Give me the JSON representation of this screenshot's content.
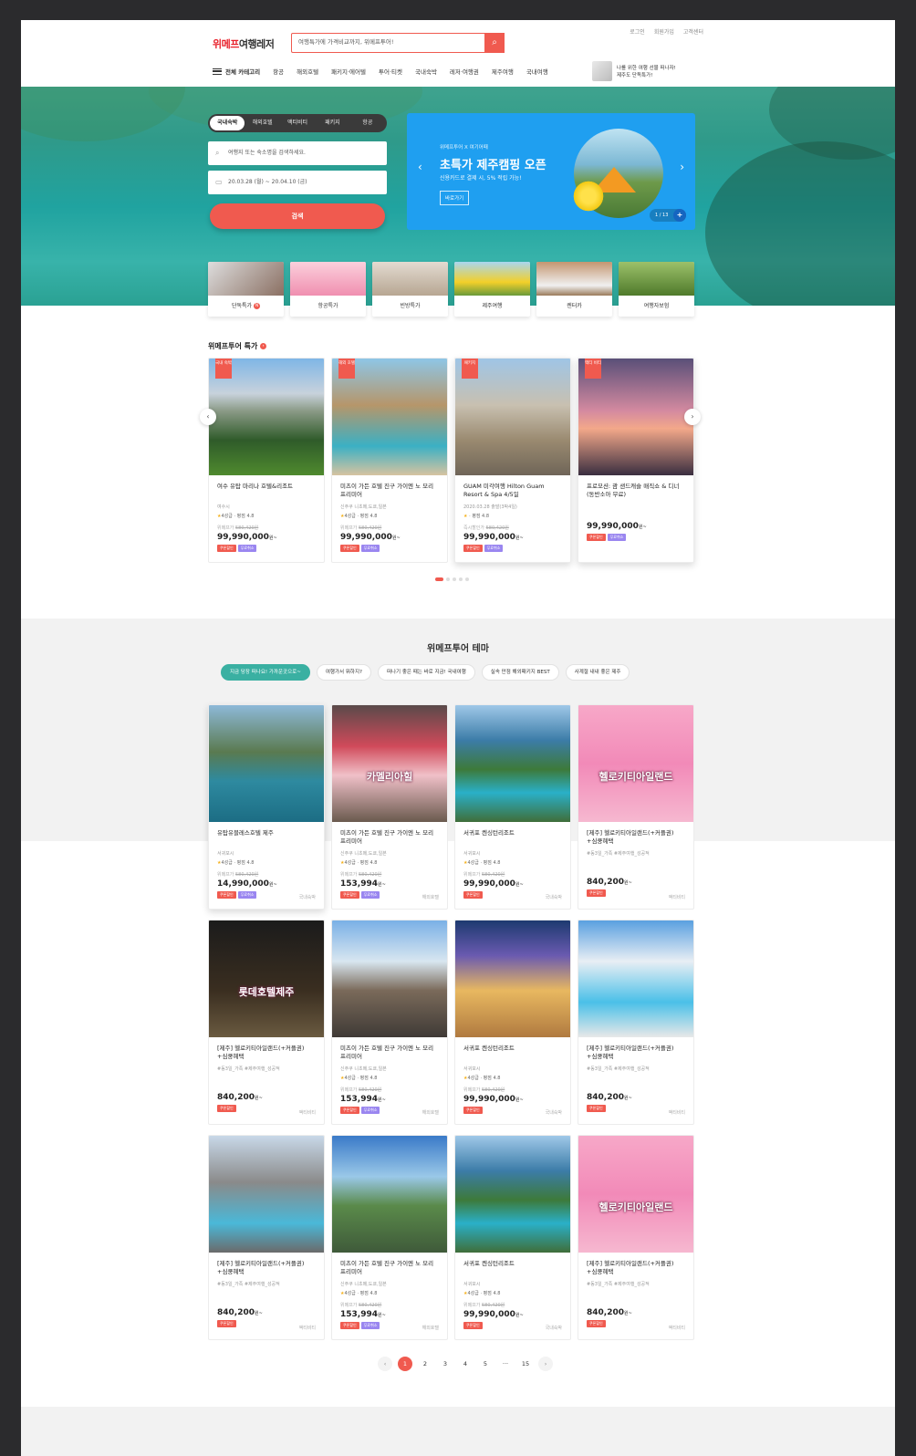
{
  "header": {
    "util": [
      "로그인",
      "회원가입",
      "고객센터"
    ],
    "logo_red": "위메프",
    "logo_dark": "여행레저",
    "search_placeholder": "여행특가에 가격비교까지, 위메프투어!",
    "menu_label": "전체 카테고리",
    "nav": [
      "항공",
      "해외호텔",
      "패키지·에어텔",
      "투어·티켓",
      "국내숙박",
      "레저·여행권",
      "제주여행",
      "국내여행"
    ],
    "promo_line1": "나를 위한 여행 선물 떠나자!",
    "promo_line2": "제주도 단독특가!"
  },
  "hero": {
    "tabs": [
      "국내숙박",
      "해외호텔",
      "액티비티",
      "패키지",
      "항공"
    ],
    "search_placeholder": "여행지 또는 숙소명을 검색하세요.",
    "dates": "20.03.28 (월) ~ 20.04.10 (금)",
    "search_button": "검색",
    "banner": {
      "sub": "위메프투어 X 여기어때",
      "title": "초특가 제주캠핑 오픈",
      "desc": "신용카드로 결제 시, 5% 적립 가능!",
      "go": "바로가기",
      "counter": "1 / 13"
    },
    "quick": [
      "단독특가",
      "항공특가",
      "빈방특가",
      "제주여행",
      "렌터카",
      "여행자보험"
    ]
  },
  "special": {
    "title": "위메프투어 특가",
    "cards": [
      {
        "tag": "국내\n숙박",
        "title": "여수 유탑 마리나 호텔&리조트",
        "loc": "여수시",
        "grade": "4성급",
        "rating": "평점 4.8",
        "orig_label": "위메프가",
        "orig": "580,420원",
        "price": "99,990,000",
        "unit": "원~",
        "tags": [
          "쿠폰할인",
          "무료취소"
        ]
      },
      {
        "tag": "해외\n호텔",
        "title": "미츠이 가든 호텔 진구 가이엔 노 모리 프리미어",
        "loc": "신주쿠 니초메,도쿄,일본",
        "grade": "4성급",
        "rating": "평점 4.8",
        "orig_label": "위메프가",
        "orig": "580,420원",
        "price": "99,990,000",
        "unit": "원~",
        "tags": [
          "쿠폰할인",
          "무료취소"
        ]
      },
      {
        "tag": "패키지",
        "title": "GUAM 미각여행 Hilton Guam Resort & Spa 4/5일",
        "loc": "2020.03.28 출발(3박4일)",
        "grade": "",
        "rating": "평점 4.8",
        "orig_label": "즉시할인가",
        "orig": "580,420원",
        "price": "99,990,000",
        "unit": "원~",
        "tags": [
          "쿠폰할인",
          "무료취소"
        ]
      },
      {
        "tag": "액티\n비티",
        "title": "프로모션: 괌 샌드캐슬 매직쇼 & 디너 (동반소아 무료)",
        "loc": "",
        "grade": "",
        "rating": "",
        "orig_label": "",
        "orig": "",
        "price": "99,990,000",
        "unit": "원~",
        "tags": [
          "쿠폰할인",
          "무료취소"
        ]
      }
    ]
  },
  "theme": {
    "title": "위메프투어 테마",
    "chips": [
      "지금 당장 떠나요! 가까운곳으로~",
      "여행가서 뭐하지?",
      "떠나기 좋은 때는 바로 지금! 국내여행",
      "실속 만점 해외패키지 BEST",
      "사계절 내내 좋은 제주"
    ],
    "cards": [
      {
        "title": "유탑유블레스호텔 제주",
        "loc": "서귀포시",
        "grade": "4성급",
        "rating": "평점 4.8",
        "orig_label": "위메프가",
        "orig": "580,420원",
        "price": "14,990,000",
        "unit": "원~",
        "tags": [
          "쿠폰할인",
          "무료취소"
        ],
        "type": "국내숙박",
        "img": "a"
      },
      {
        "title": "미츠이 가든 호텔 진구 가이엔 노 모리 프리미어",
        "loc": "신주쿠 니초메,도쿄,일본",
        "grade": "4성급",
        "rating": "평점 4.8",
        "orig_label": "위메프가",
        "orig": "580,420원",
        "price": "153,994",
        "unit": "원~",
        "tags": [
          "쿠폰할인",
          "무료취소"
        ],
        "type": "해외호텔",
        "img": "b",
        "overlay": "카멜리아힐"
      },
      {
        "title": "서귀포 켄싱턴리조트",
        "loc": "서귀포시",
        "grade": "4성급",
        "rating": "평점 4.8",
        "orig_label": "위메프가",
        "orig": "580,420원",
        "price": "99,990,000",
        "unit": "원~",
        "tags": [
          "쿠폰할인"
        ],
        "type": "국내숙박",
        "img": "c"
      },
      {
        "title": "[제주] 헬로키티아일랜드(+커플권) +심쿵혜택",
        "loc": "#동3일_가족 #제주여행_성공적",
        "grade": "",
        "rating": "",
        "orig_label": "",
        "orig": "",
        "price": "840,200",
        "unit": "원~",
        "tags": [
          "쿠폰할인"
        ],
        "type": "액티비티",
        "img": "d",
        "overlay": "헬로키티아일랜드"
      },
      {
        "title": "[제주] 헬로키티아일랜드(+커플권) +심쿵혜택",
        "loc": "#동3일_가족 #제주여행_성공적",
        "grade": "",
        "rating": "",
        "orig_label": "",
        "orig": "",
        "price": "840,200",
        "unit": "원~",
        "tags": [
          "쿠폰할인"
        ],
        "type": "액티비티",
        "img": "e",
        "overlay": "롯데호텔제주"
      },
      {
        "title": "미츠이 가든 호텔 진구 가이엔 노 모리 프리미어",
        "loc": "신주쿠 니초메,도쿄,일본",
        "grade": "4성급",
        "rating": "평점 4.8",
        "orig_label": "위메프가",
        "orig": "580,420원",
        "price": "153,994",
        "unit": "원~",
        "tags": [
          "쿠폰할인",
          "무료취소"
        ],
        "type": "해외호텔",
        "img": "f"
      },
      {
        "title": "서귀포 켄싱턴리조트",
        "loc": "서귀포시",
        "grade": "4성급",
        "rating": "평점 4.8",
        "orig_label": "위메프가",
        "orig": "580,420원",
        "price": "99,990,000",
        "unit": "원~",
        "tags": [
          "쿠폰할인"
        ],
        "type": "국내숙박",
        "img": "g"
      },
      {
        "title": "[제주] 헬로키티아일랜드(+커플권) +심쿵혜택",
        "loc": "#동3일_가족 #제주여행_성공적",
        "grade": "",
        "rating": "",
        "orig_label": "",
        "orig": "",
        "price": "840,200",
        "unit": "원~",
        "tags": [
          "쿠폰할인"
        ],
        "type": "액티비티",
        "img": "h"
      },
      {
        "title": "[제주] 헬로키티아일랜드(+커플권) +심쿵혜택",
        "loc": "#동3일_가족 #제주여행_성공적",
        "grade": "",
        "rating": "",
        "orig_label": "",
        "orig": "",
        "price": "840,200",
        "unit": "원~",
        "tags": [
          "쿠폰할인"
        ],
        "type": "액티비티",
        "img": "i"
      },
      {
        "title": "미츠이 가든 호텔 진구 가이엔 노 모리 프리미어",
        "loc": "신주쿠 니초메,도쿄,일본",
        "grade": "4성급",
        "rating": "평점 4.8",
        "orig_label": "위메프가",
        "orig": "580,420원",
        "price": "153,994",
        "unit": "원~",
        "tags": [
          "쿠폰할인",
          "무료취소"
        ],
        "type": "해외호텔",
        "img": "j"
      },
      {
        "title": "서귀포 켄싱턴리조트",
        "loc": "서귀포시",
        "grade": "4성급",
        "rating": "평점 4.8",
        "orig_label": "위메프가",
        "orig": "580,420원",
        "price": "99,990,000",
        "unit": "원~",
        "tags": [
          "쿠폰할인"
        ],
        "type": "국내숙박",
        "img": "c"
      },
      {
        "title": "[제주] 헬로키티아일랜드(+커플권) +심쿵혜택",
        "loc": "#동3일_가족 #제주여행_성공적",
        "grade": "",
        "rating": "",
        "orig_label": "",
        "orig": "",
        "price": "840,200",
        "unit": "원~",
        "tags": [
          "쿠폰할인"
        ],
        "type": "액티비티",
        "img": "d",
        "overlay": "헬로키티아일랜드"
      }
    ]
  },
  "pager": [
    "‹",
    "1",
    "2",
    "3",
    "4",
    "5",
    "···",
    "15",
    "›"
  ],
  "colors": {
    "accent": "#f05a4f",
    "teal": "#3ab0a2",
    "banner": "#1f9ff0"
  }
}
